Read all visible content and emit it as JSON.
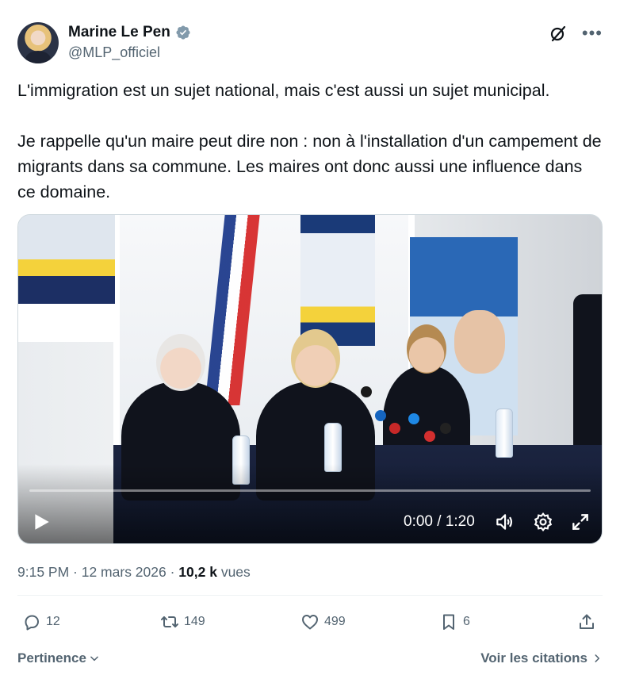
{
  "author": {
    "name": "Marine Le Pen",
    "handle": "@MLP_officiel",
    "verified": true,
    "verified_color": "#829aab"
  },
  "tweet": {
    "paragraphs": [
      "L'immigration est un sujet national, mais c'est aussi un sujet municipal.",
      "Je rappelle qu'un maire peut dire non : non à l'installation d'un campement de migrants dans sa commune. Les maires ont donc aussi une influence dans ce domaine."
    ]
  },
  "video": {
    "time": "0:00 / 1:20",
    "progress": 0.0
  },
  "meta": {
    "timestamp": "9:15 PM · 12 mars 2026 ·",
    "views_count": "10,2 k",
    "views_label": "vues"
  },
  "actions": {
    "replies": "12",
    "reposts": "149",
    "likes": "499",
    "bookmarks": "6"
  },
  "footer": {
    "sort_label": "Pertinence",
    "quotes_label": "Voir les citations"
  },
  "colors": {
    "text_primary": "#0f1419",
    "text_secondary": "#536471",
    "accent": "#1d9bf0"
  },
  "icons": [
    "verified-badge-icon",
    "grok-icon",
    "more-icon",
    "play-icon",
    "volume-icon",
    "settings-icon",
    "fullscreen-icon",
    "reply-icon",
    "repost-icon",
    "like-icon",
    "bookmark-icon",
    "share-icon",
    "chevron-down-icon",
    "chevron-right-icon"
  ]
}
